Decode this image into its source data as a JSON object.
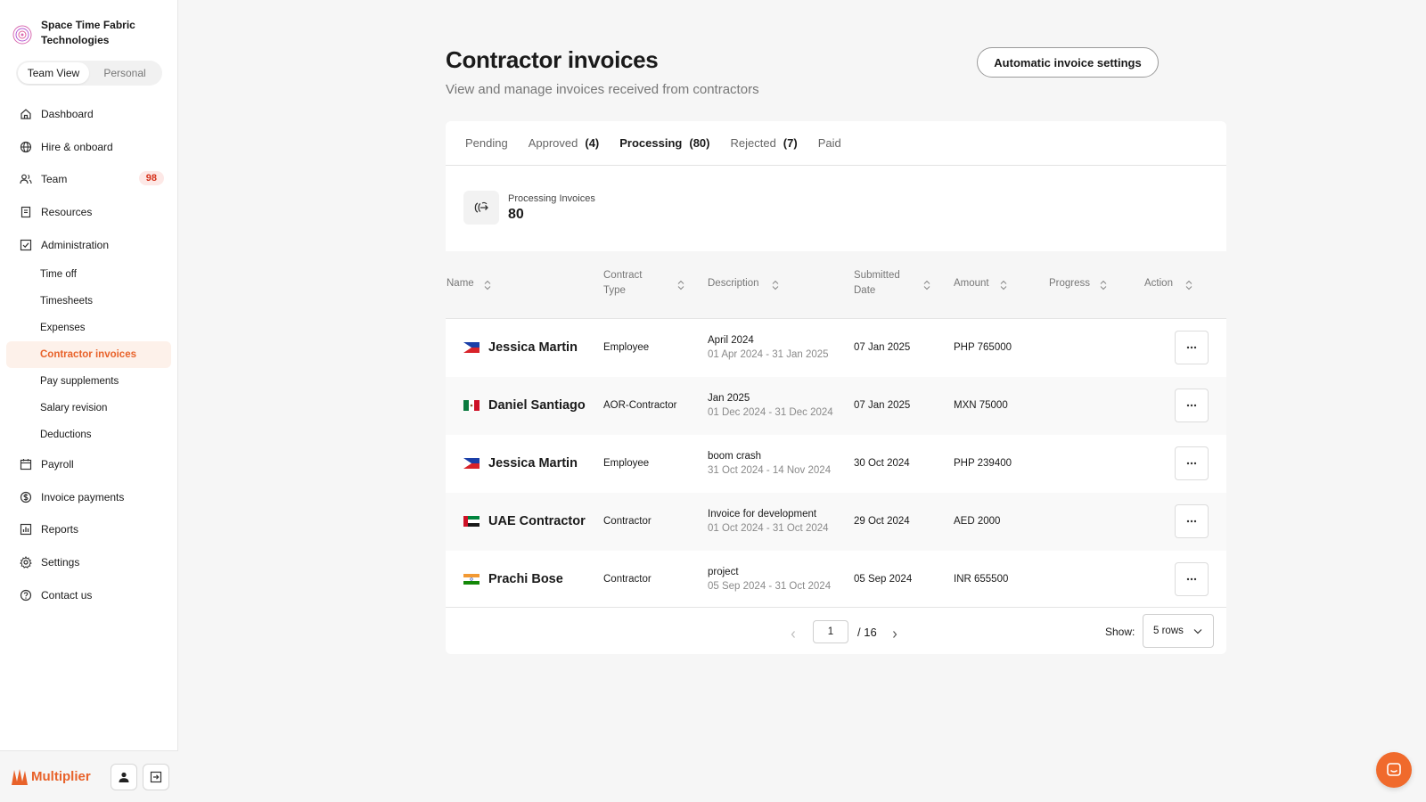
{
  "org": {
    "name": "Space Time Fabric Technologies"
  },
  "view_toggle": {
    "team": "Team View",
    "personal": "Personal"
  },
  "nav": {
    "dashboard": "Dashboard",
    "hire": "Hire & onboard",
    "team": "Team",
    "team_badge": "98",
    "resources": "Resources",
    "administration": "Administration",
    "sub": {
      "time_off": "Time off",
      "timesheets": "Timesheets",
      "expenses": "Expenses",
      "contractor_invoices": "Contractor invoices",
      "pay_supplements": "Pay supplements",
      "salary_revision": "Salary revision",
      "deductions": "Deductions"
    },
    "payroll": "Payroll",
    "invoice_payments": "Invoice payments",
    "reports": "Reports",
    "settings": "Settings",
    "contact": "Contact us"
  },
  "footer": {
    "brand": "Multiplier"
  },
  "page": {
    "title": "Contractor invoices",
    "subtitle": "View and manage invoices received from contractors",
    "settings_button": "Automatic invoice settings"
  },
  "tabs": [
    {
      "label": "Pending",
      "count": ""
    },
    {
      "label": "Approved",
      "count": "(4)"
    },
    {
      "label": "Processing",
      "count": "(80)"
    },
    {
      "label": "Rejected",
      "count": "(7)"
    },
    {
      "label": "Paid",
      "count": ""
    }
  ],
  "summary": {
    "label": "Processing Invoices",
    "value": "80"
  },
  "table": {
    "headers": {
      "name": "Name",
      "contract_type_1": "Contract",
      "contract_type_2": "Type",
      "description": "Description",
      "submitted_1": "Submitted",
      "submitted_2": "Date",
      "amount": "Amount",
      "progress": "Progress",
      "action": "Action"
    },
    "rows": [
      {
        "name": "Jessica Martin",
        "flag": "PH",
        "contract_type": "Employee",
        "desc": "April 2024",
        "period": "01 Apr 2024 - 31 Jan 2025",
        "submitted": "07 Jan 2025",
        "amount": "PHP 765000"
      },
      {
        "name": "Daniel Santiago",
        "flag": "MX",
        "contract_type": "AOR-Contractor",
        "desc": "Jan 2025",
        "period": "01 Dec 2024 - 31 Dec 2024",
        "submitted": "07 Jan 2025",
        "amount": "MXN 75000"
      },
      {
        "name": "Jessica Martin",
        "flag": "PH",
        "contract_type": "Employee",
        "desc": "boom crash",
        "period": "31 Oct 2024 - 14 Nov 2024",
        "submitted": "30 Oct 2024",
        "amount": "PHP 239400"
      },
      {
        "name": "UAE Contractor",
        "flag": "AE",
        "contract_type": "Contractor",
        "desc": "Invoice for development",
        "period": "01 Oct 2024 - 31 Oct 2024",
        "submitted": "29 Oct 2024",
        "amount": "AED 2000"
      },
      {
        "name": "Prachi Bose",
        "flag": "IN",
        "contract_type": "Contractor",
        "desc": "project",
        "period": "05 Sep 2024 - 31 Oct 2024",
        "submitted": "05 Sep 2024",
        "amount": "INR 655500"
      }
    ]
  },
  "pagination": {
    "current_page": "1",
    "total": "/ 16",
    "show_label": "Show:",
    "rows_option": "5 rows"
  },
  "colors": {
    "accent": "#e8622a",
    "badge_bg": "#fde8e6",
    "badge_text": "#d6321b",
    "chat": "#f06a2c"
  }
}
